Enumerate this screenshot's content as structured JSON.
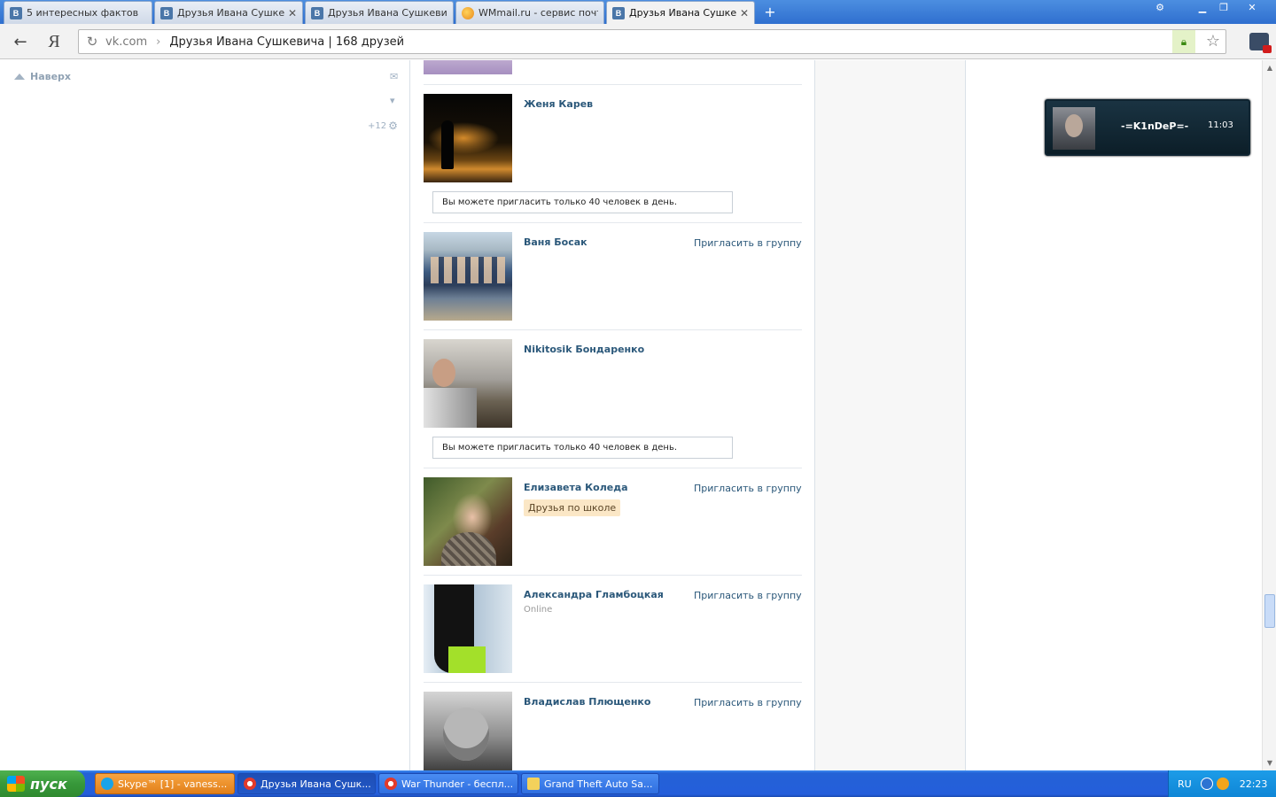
{
  "browser": {
    "tabs": [
      {
        "label": "5 интересных фактов",
        "favicon": "vk-icon",
        "active": false,
        "closable": false
      },
      {
        "label": "Друзья Ивана Сушкеви",
        "favicon": "vk-icon",
        "active": false,
        "closable": true
      },
      {
        "label": "Друзья Ивана Сушкеви",
        "favicon": "vk-icon",
        "active": false,
        "closable": false
      },
      {
        "label": "WMmail.ru - сервис почт",
        "favicon": "wmmail-icon",
        "active": false,
        "closable": false
      },
      {
        "label": "Друзья Ивана Сушкеви",
        "favicon": "vk-icon",
        "active": true,
        "closable": true
      }
    ],
    "new_tab": "+",
    "yandex_button": "Я",
    "address": {
      "domain": "vk.com",
      "separator": "›",
      "title": "Друзья Ивана Сушкевича | 168 друзей"
    }
  },
  "sidebar": {
    "back_to_top": "Наверх",
    "counter": "+12"
  },
  "friends": [
    {
      "name": "Женя Карев",
      "invite": "",
      "status": "",
      "tag": "",
      "photo": "city-night"
    },
    {
      "name": "Ваня Босак",
      "invite": "Пригласить в группу",
      "status": "",
      "tag": "",
      "photo": "group"
    },
    {
      "name": "Nikitosik Бондаренко",
      "invite": "",
      "status": "",
      "tag": "",
      "photo": "field"
    },
    {
      "name": "Елизавета Коледа",
      "invite": "Пригласить в группу",
      "status": "",
      "tag": "Друзья по школе",
      "photo": "girl-scarf"
    },
    {
      "name": "Александра Гламбоцкая",
      "invite": "Пригласить в группу",
      "status": "Online",
      "tag": "",
      "photo": "girl-dark"
    },
    {
      "name": "Владислав Плющенко",
      "invite": "Пригласить в группу",
      "status": "",
      "tag": "",
      "photo": "bw-portrait"
    }
  ],
  "notices": [
    "Вы можете пригласить только 40 человек в день.",
    "Вы можете пригласить только 40 человек в день."
  ],
  "skype_popup": {
    "nick": "-=K1nDeP=-",
    "time": "11:03"
  },
  "taskbar": {
    "start_label": "пуск",
    "tasks": [
      {
        "label": "Skype™ [1] - vaness...",
        "icon": "skype-icon"
      },
      {
        "label": "Друзья Ивана Сушк...",
        "icon": "yandex-browser-icon"
      },
      {
        "label": "War Thunder - беспл...",
        "icon": "yandex-browser-icon"
      },
      {
        "label": "Grand Theft Auto Sa...",
        "icon": "folder-icon"
      }
    ],
    "lang": "RU",
    "clock": "22:23"
  },
  "colors": {
    "link": "#2b587a",
    "tag_bg": "#fbe7c6",
    "taskbar": "#245edb",
    "start": "#37983a"
  }
}
